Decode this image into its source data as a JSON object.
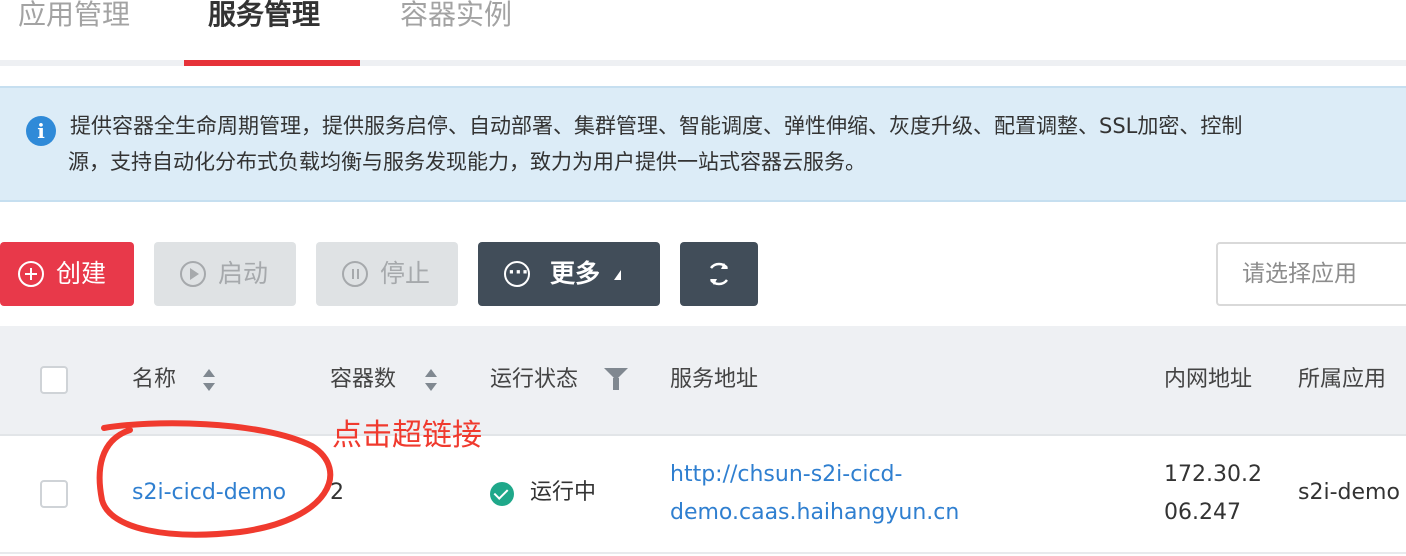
{
  "tabs": [
    {
      "label": "应用管理"
    },
    {
      "label": "服务管理"
    },
    {
      "label": "容器实例"
    }
  ],
  "active_tab": "服务管理",
  "banner": {
    "line1": "提供容器全生命周期管理，提供服务启停、自动部署、集群管理、智能调度、弹性伸缩、灰度升级、配置调整、SSL加密、控制",
    "line2": "源，支持自动化分布式负载均衡与服务发现能力，致力为用户提供一站式容器云服务。"
  },
  "toolbar": {
    "create_label": "创建",
    "start_label": "启动",
    "stop_label": "停止",
    "more_label": "更多",
    "select_placeholder": "请选择应用"
  },
  "table": {
    "columns": [
      "名称",
      "容器数",
      "运行状态",
      "服务地址",
      "内网地址",
      "所属应用"
    ],
    "rows": [
      {
        "name": "s2i-cicd-demo",
        "containers": "2",
        "status": "运行中",
        "address_line1": "http://chsun-s2i-cicd-",
        "address_line2": "demo.caas.haihangyun.cn",
        "ip_line1": "172.30.2",
        "ip_line2": "06.247",
        "app": "s2i-demo"
      }
    ]
  },
  "annotation": {
    "text": "点击超链接",
    "color": "#f03a2e"
  },
  "colors": {
    "accent": "#e63239",
    "create": "#e8394a",
    "dark_button": "#414d59",
    "link": "#2f7fd0",
    "status_ok": "#1fa88a",
    "banner_bg": "#dcecf7"
  }
}
